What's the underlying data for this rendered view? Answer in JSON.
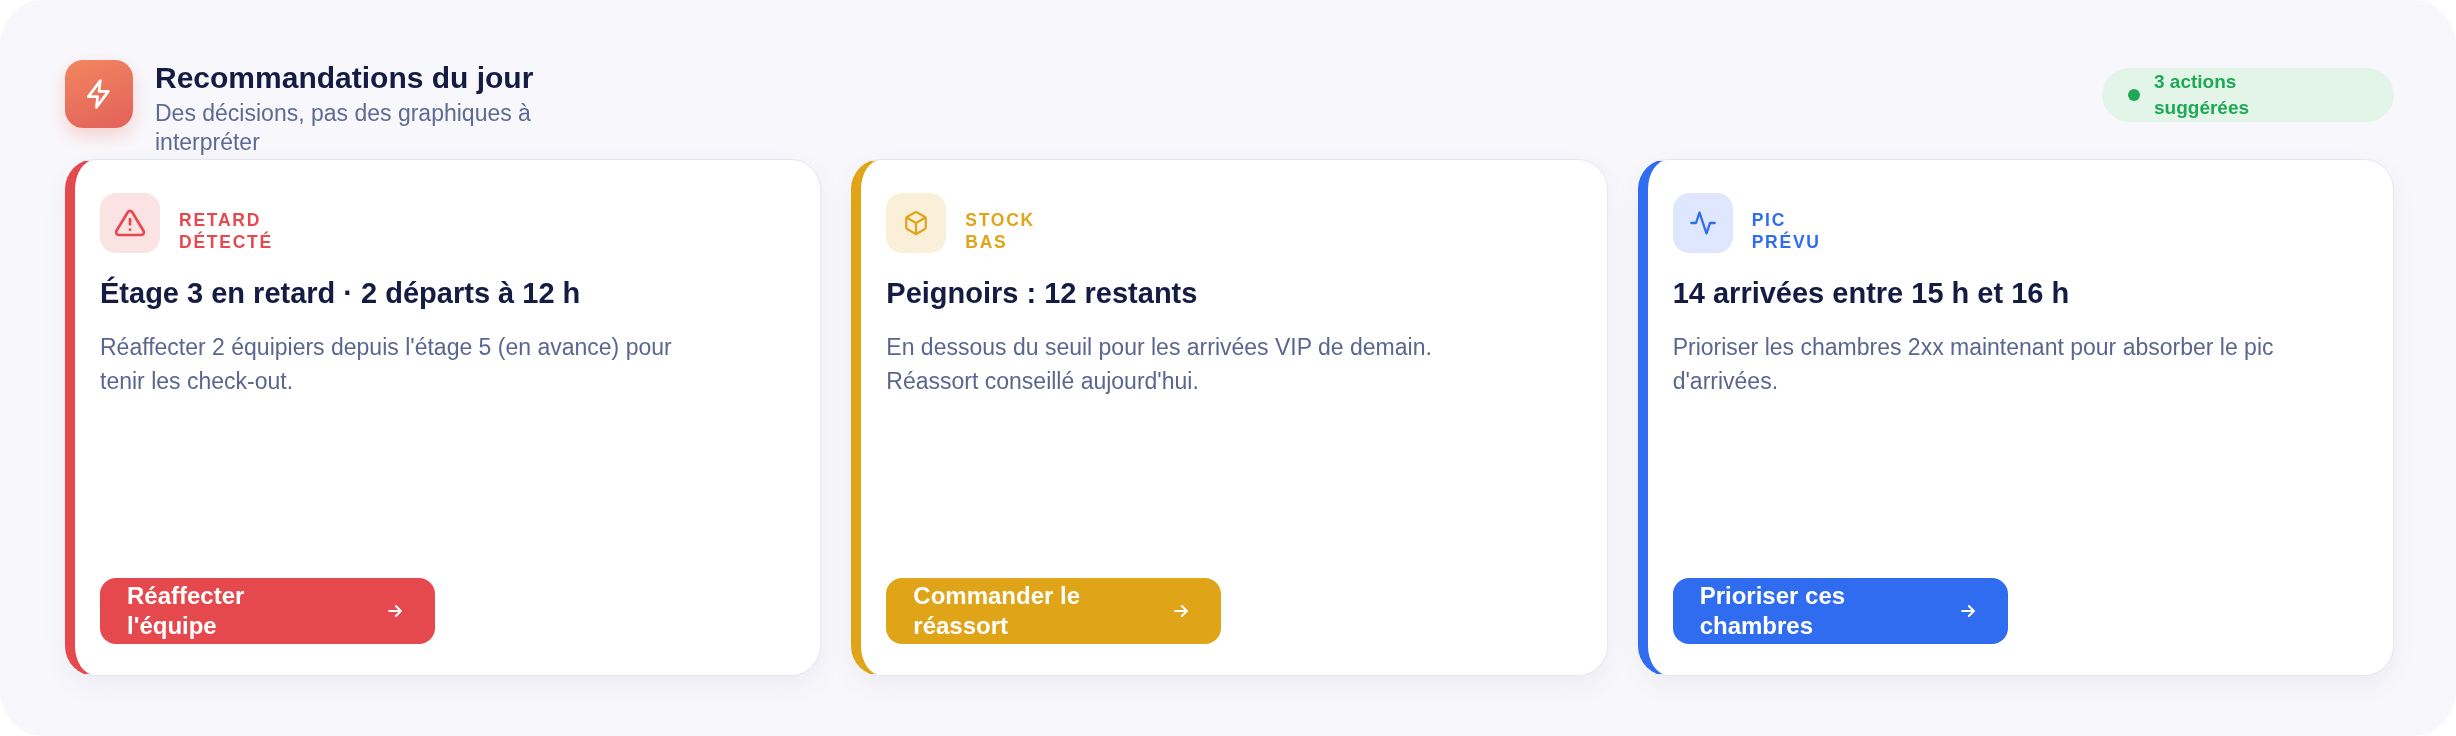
{
  "header": {
    "title": "Recommandations du jour",
    "subtitle": "Des décisions, pas des graphiques à interpréter"
  },
  "summary_badge": {
    "label": "3 actions suggérées"
  },
  "cards": [
    {
      "kind": "alert",
      "color": "#e5484d",
      "tag": "RETARD DÉTECTÉ",
      "title": "Étage 3 en retard · 2 départs à 12 h",
      "description": "Réaffecter 2 équipiers depuis l'étage 5 (en avance) pour tenir les check-out.",
      "action": "Réaffecter l'équipe"
    },
    {
      "kind": "stock",
      "color": "#dfa418",
      "tag": "STOCK BAS",
      "title": "Peignoirs : 12 restants",
      "description": "En dessous du seuil pour les arrivées VIP de demain. Réassort conseillé aujourd'hui.",
      "action": "Commander le réassort"
    },
    {
      "kind": "peak",
      "color": "#306cf0",
      "tag": "PIC PRÉVU",
      "title": "14 arrivées entre 15 h et 16 h",
      "description": "Prioriser les chambres 2xx maintenant pour absorber le pic d'arrivées.",
      "action": "Prioriser ces chambres"
    }
  ]
}
